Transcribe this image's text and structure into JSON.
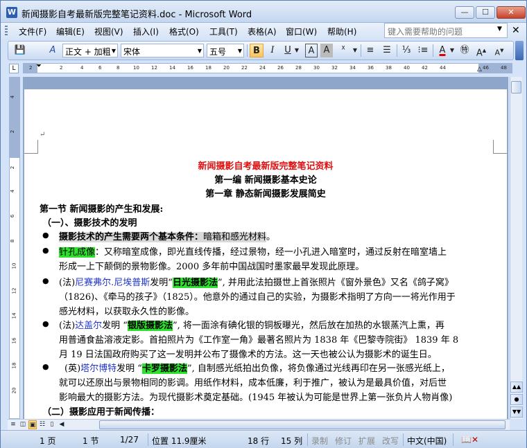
{
  "window": {
    "title": "新闻摄影自考最新版完整笔记资料.doc - Microsoft Word",
    "app_icon": "W"
  },
  "menu": [
    "文件(F)",
    "编辑(E)",
    "视图(V)",
    "插入(I)",
    "格式(O)",
    "工具(T)",
    "表格(A)",
    "窗口(W)",
    "帮助(H)"
  ],
  "help_placeholder": "键入需要帮助的问题",
  "toolbar": {
    "style": "正文 + 加粗",
    "font": "宋体",
    "size": "五号",
    "bold": "B",
    "italic": "I",
    "underline": "U",
    "char_border": "A",
    "char_shading": "A",
    "zoom_in": "A",
    "zoom_out": "A"
  },
  "ruler": {
    "ticks": [
      "2",
      "2",
      "4",
      "6",
      "8",
      "10",
      "12",
      "14",
      "16",
      "18",
      "20",
      "22",
      "24",
      "26",
      "28",
      "30",
      "32",
      "34",
      "36",
      "38",
      "40",
      "42",
      "44",
      "46",
      "48"
    ],
    "vticks": [
      "4",
      "2",
      "2",
      "4",
      "6",
      "8",
      "10",
      "12",
      "14",
      "16",
      "18",
      "20"
    ]
  },
  "doc": {
    "title": "新闻摄影自考最新版完整笔记资料",
    "part": "第一编  新闻摄影基本史论",
    "chapter": "第一章 静态新闻摄影发展简史",
    "section": "第一节 新闻摄影的产生和发展:",
    "sub1": "（一）、摄影技术的发明",
    "b1a": "摄影技术的产生需要两个基本条件：",
    "b1b": "暗箱和感光材料",
    "b1c": "。",
    "b2a": "针孔成像",
    "b2b": "：又称暗室成像，即光直线传播，经过景物，经一小孔进入暗室时，通过反射在暗室墙上",
    "b2c": "形成一上下颠倒的景物影像。2000 多年前中国战国时墨家最早发现此原理。",
    "b3a": "(法)",
    "b3b": "尼赛弗尔.尼埃普斯",
    "b3c": "发明“",
    "b3d": "日光摄影法",
    "b3e": "”, 并用此法拍摄世上首张照片《窗外景色》又名《鸽子窝》",
    "b3f": "（1826)、《牵马的孩子》（1825）。他意外的通过自己的实验，为摄影术指明了方向一一将光作用于",
    "b3g": "感光材料，以获取永久性的影像。",
    "b4a": "(法)",
    "b4b": "达盖尔",
    "b4c": "发明 “",
    "b4d": "银版摄影法",
    "b4e": "”, 将一面涂有碘化银的铜板曝光，然后放在加热的水银蒸汽上熏，再",
    "b4f": "用普通食盐溶液定影。首拍照片为《工作室一角》最著名照片为 1838 年《巴黎寺院街》 1839 年 8",
    "b4g": "月 19 日法国政府购买了这一发明并公布了摄像术的方法。这一天也被公认为摄影术的诞生日。",
    "b5a": "(英)",
    "b5b": "塔尔博特",
    "b5c": "发明 “",
    "b5d": "卡罗摄影法",
    "b5e": "”, 自制感光纸拍出负像，将负像通过光线再印在另一张感光纸上，",
    "b5f": "就可以还原出与景物相同的影调。用纸作材料，成本低廉，利于推广，被认为是最具价值，对后世",
    "b5g": "影响最大的摄影方法。为现代摄影术奠定基础。(1945 年被认为可能是世界上第一张负片人物肖像)",
    "sub2": "（二）摄影应用于新闻传播："
  },
  "status": {
    "page": "1 页",
    "section": "1 节",
    "pages": "1/27",
    "position": "位置 11.9厘米",
    "row": "18 行",
    "col": "15 列",
    "rec": "录制",
    "trk": "修订",
    "ext": "扩展",
    "ovr": "改写",
    "lang": "中文(中国)"
  }
}
